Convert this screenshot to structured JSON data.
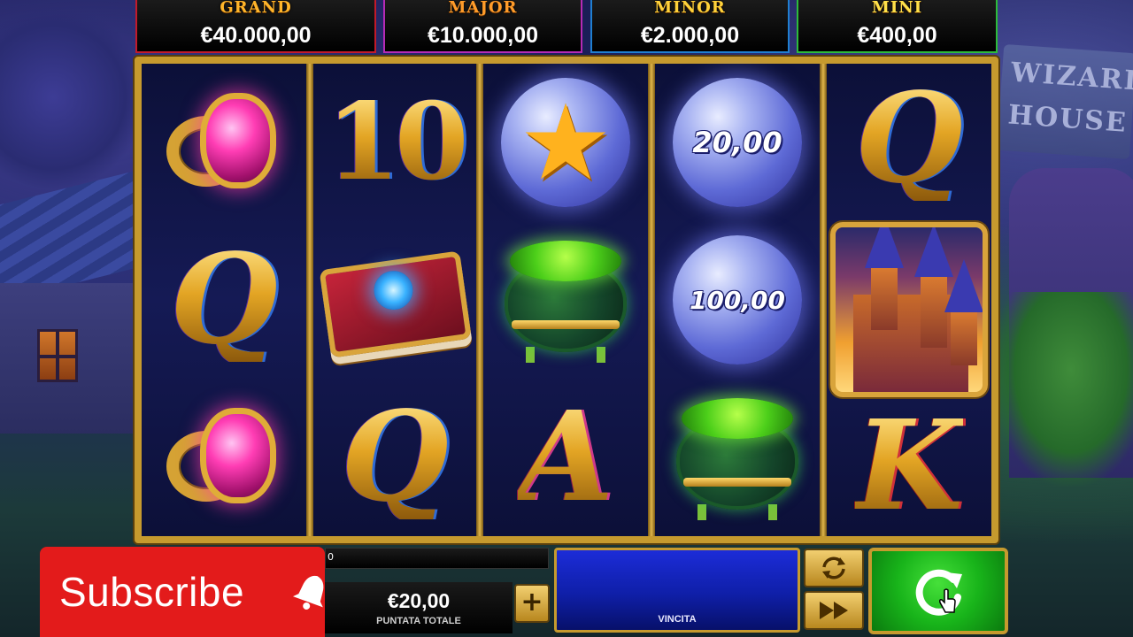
{
  "jackpots": [
    {
      "name": "GRAND",
      "value": "€40.000,00"
    },
    {
      "name": "MAJOR",
      "value": "€10.000,00"
    },
    {
      "name": "MINOR",
      "value": "€2.000,00"
    },
    {
      "name": "MINI",
      "value": "€400,00"
    }
  ],
  "scene": {
    "sign_text": "WIZARD HOUSE"
  },
  "reels": {
    "reel1": [
      "ring-gem-icon",
      "Q",
      "ring-gem-icon"
    ],
    "reel2": [
      "10",
      "spellbook-icon",
      "Q"
    ],
    "reel3": [
      "star-orb-icon",
      "cauldron-icon",
      "A"
    ],
    "reel4": [
      "20,00",
      "100,00",
      "cauldron-icon"
    ],
    "reel5": [
      "Q",
      "castle-wild-icon",
      "K"
    ],
    "symbols": {
      "r2_top": "10",
      "r1_mid": "Q",
      "r2_bottom": "Q",
      "r3_bottom": "A",
      "r5_top": "Q",
      "r5_bottom": "K",
      "orb_top": "20,00",
      "orb_mid": "100,00"
    }
  },
  "controls": {
    "subscribe_label": "Subscribe",
    "bet_value": "€20,00",
    "bet_label": "PUNTATA TOTALE",
    "plus_label": "+",
    "win_label": "VINCITA",
    "info_text": "0"
  },
  "colors": {
    "frame_gold": "#c69a2e",
    "spin_green": "#18b41a",
    "win_blue": "#0f1fa8",
    "subscribe_red": "#e31b1b"
  }
}
